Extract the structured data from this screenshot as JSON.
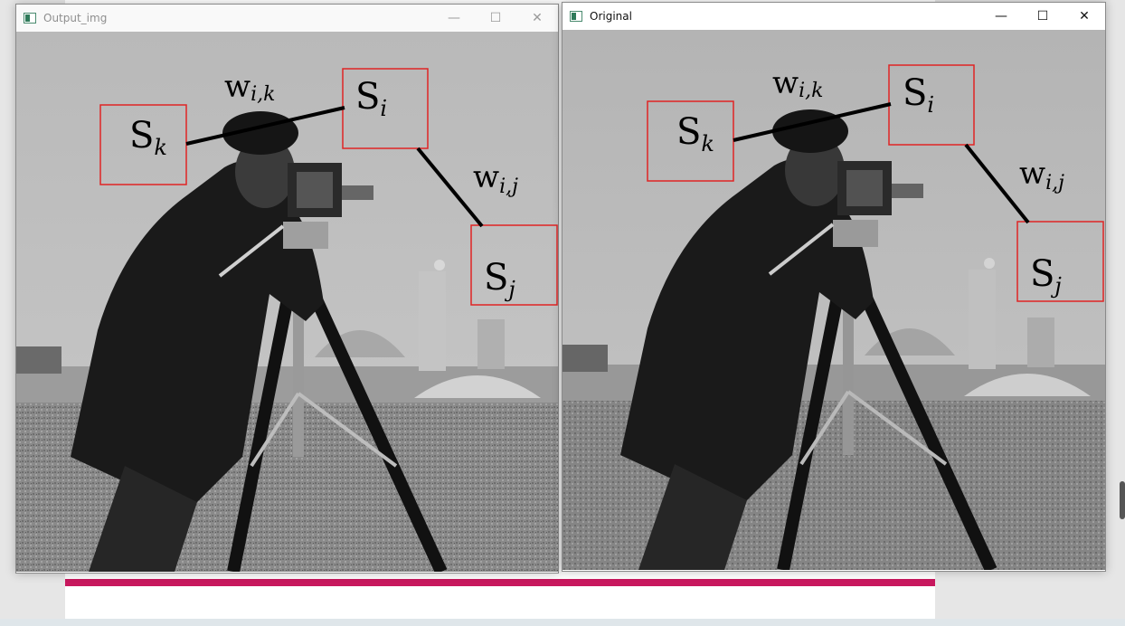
{
  "windows": [
    {
      "title": "Output_img",
      "controls": {
        "minimize": "—",
        "maximize": "☐",
        "close": "✕"
      },
      "image_alt": "cameraman",
      "annotations": {
        "s_k": "S",
        "s_k_sub": "k",
        "s_i": "S",
        "s_i_sub": "i",
        "s_j": "S",
        "s_j_sub": "j",
        "w_ik": "w",
        "w_ik_sub": "i,k",
        "w_ij": "w",
        "w_ij_sub": "i,j"
      }
    },
    {
      "title": "Original",
      "controls": {
        "minimize": "—",
        "maximize": "☐",
        "close": "✕"
      },
      "image_alt": "cameraman",
      "annotations": {
        "s_k": "S",
        "s_k_sub": "k",
        "s_i": "S",
        "s_i_sub": "i",
        "s_j": "S",
        "s_j_sub": "j",
        "w_ik": "w",
        "w_ik_sub": "i,k",
        "w_ij": "w",
        "w_ij_sub": "i,j"
      }
    }
  ],
  "colors": {
    "box": "#e02424",
    "stripe": "#c8185e",
    "line": "#000000"
  }
}
